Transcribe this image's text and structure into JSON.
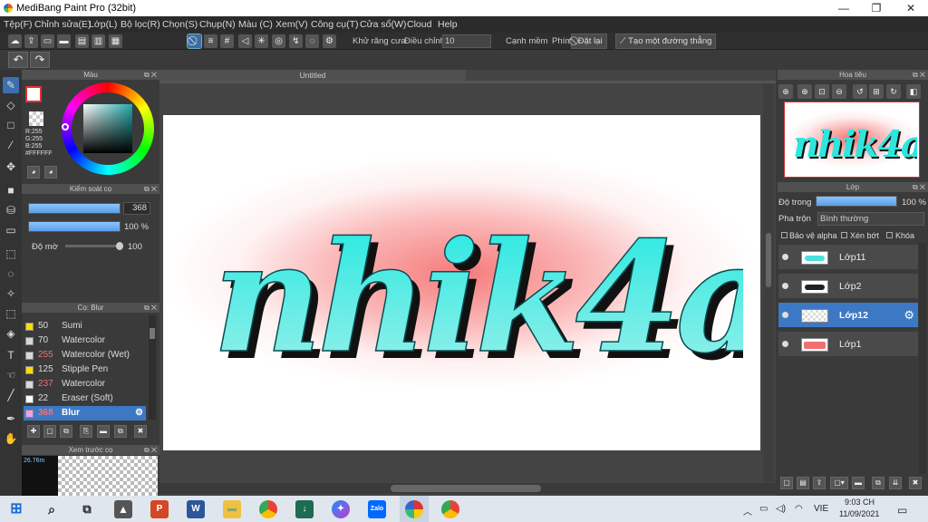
{
  "window": {
    "title": "MediBang Paint Pro (32bit)",
    "minimize": "—",
    "maximize": "❐",
    "close": "✕"
  },
  "menu": [
    "Tệp(F)",
    "Chỉnh sửa(E)",
    "Lớp(L)",
    "Bộ lọc(R)",
    "Chọn(S)",
    "Chụp(N)",
    "Màu (C)",
    "Xem(V)",
    "Công cụ(T)",
    "Cửa sổ(W)",
    "Cloud",
    "Help"
  ],
  "toolbar": {
    "antialias_label": "Khử răng cưa",
    "correction_label": "Điều chỉnh",
    "correction_value": "10",
    "edge_label": "Cạnh mềm",
    "shortcut_label": "Phím",
    "reset_label": "Đặt lại",
    "straight_label": "Tạo một đường thẳng"
  },
  "color_panel": {
    "title": "Màu",
    "r": "R:255",
    "g": "G:255",
    "b": "B:255",
    "hex": "#FFFFFF"
  },
  "brush_control": {
    "title": "Kiểm soát cọ",
    "size": "368",
    "opacity": "100 %",
    "opacity_fill": 100,
    "size_fill": 100,
    "density_label": "Độ mờ",
    "density_value": "100"
  },
  "brush_panel": {
    "title": "Cọ: Blur",
    "items": [
      {
        "size": "50",
        "name": "Sumi",
        "color": "#f5e000",
        "size_color": "#ddd"
      },
      {
        "size": "70",
        "name": "Watercolor",
        "color": "#d8d8d8",
        "size_color": "#ddd"
      },
      {
        "size": "255",
        "name": "Watercolor (Wet)",
        "color": "#d8d8d8",
        "size_color": "#f07070"
      },
      {
        "size": "125",
        "name": "Stipple Pen",
        "color": "#f5e000",
        "size_color": "#ddd"
      },
      {
        "size": "237",
        "name": "Watercolor",
        "color": "#d8d8d8",
        "size_color": "#f07070"
      },
      {
        "size": "22",
        "name": "Eraser (Soft)",
        "color": "#ffffff",
        "size_color": "#ddd"
      },
      {
        "size": "368",
        "name": "Blur",
        "color": "#f0a0e0",
        "size_color": "#f07070",
        "selected": true
      }
    ]
  },
  "preview_panel": {
    "title": "Xem trước cọ",
    "size_text": "26.76m"
  },
  "document": {
    "tab": "Untitled",
    "artwork_text": "nhik4a"
  },
  "navigator": {
    "title": "Hoa tiêu"
  },
  "layers_panel": {
    "title": "Lớp",
    "opacity_label": "Độ trong",
    "opacity_value": "100 %",
    "blend_label": "Pha trộn",
    "blend_value": "Bình thường",
    "protect_alpha": "Bảo vệ alpha",
    "clipping": "Xén bớt",
    "lock": "Khóa",
    "layers": [
      {
        "name": "Lớp11",
        "selected": false
      },
      {
        "name": "Lớp2",
        "selected": false
      },
      {
        "name": "Lớp12",
        "selected": true
      },
      {
        "name": "Lớp1",
        "selected": false
      }
    ]
  },
  "taskbar": {
    "lang": "VIE",
    "time": "9:03 CH",
    "date": "11/09/2021",
    "zalo": "Zalo"
  }
}
